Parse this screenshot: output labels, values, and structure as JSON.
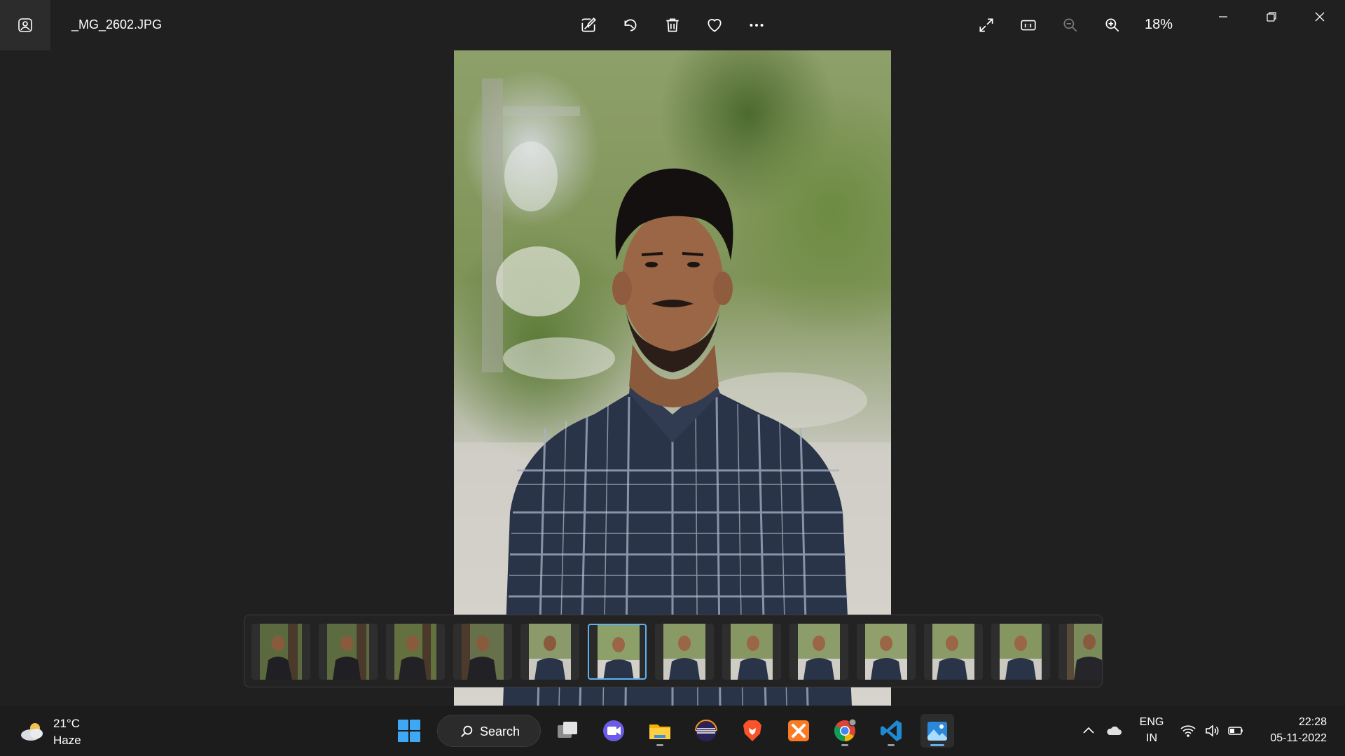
{
  "window": {
    "file_name": "_MG_2602.JPG",
    "zoom_level": "18%"
  },
  "toolbar": {
    "icons": [
      "edit-image-icon",
      "rotate-icon",
      "delete-icon",
      "favorite-heart-icon",
      "more-options-icon"
    ],
    "right_icons": [
      "fullscreen-icon",
      "actual-size-icon",
      "zoom-out-icon",
      "zoom-in-icon"
    ]
  },
  "filmstrip": {
    "thumbnail_count": 13,
    "selected_index": 5
  },
  "taskbar": {
    "weather": {
      "temperature": "21°C",
      "condition": "Haze"
    },
    "search_label": "Search",
    "apps": [
      "start-icon",
      "task-view-icon",
      "teams-chat-icon",
      "file-explorer-icon",
      "eclipse-icon",
      "brave-icon",
      "xampp-icon",
      "chrome-icon",
      "vscode-icon",
      "photos-icon"
    ],
    "tray": {
      "language_line1": "ENG",
      "language_line2": "IN",
      "time": "22:28",
      "date": "05-11-2022"
    }
  },
  "colors": {
    "background": "#202020",
    "accent": "#5fb2f2",
    "taskbar": "#1c1c1c"
  }
}
